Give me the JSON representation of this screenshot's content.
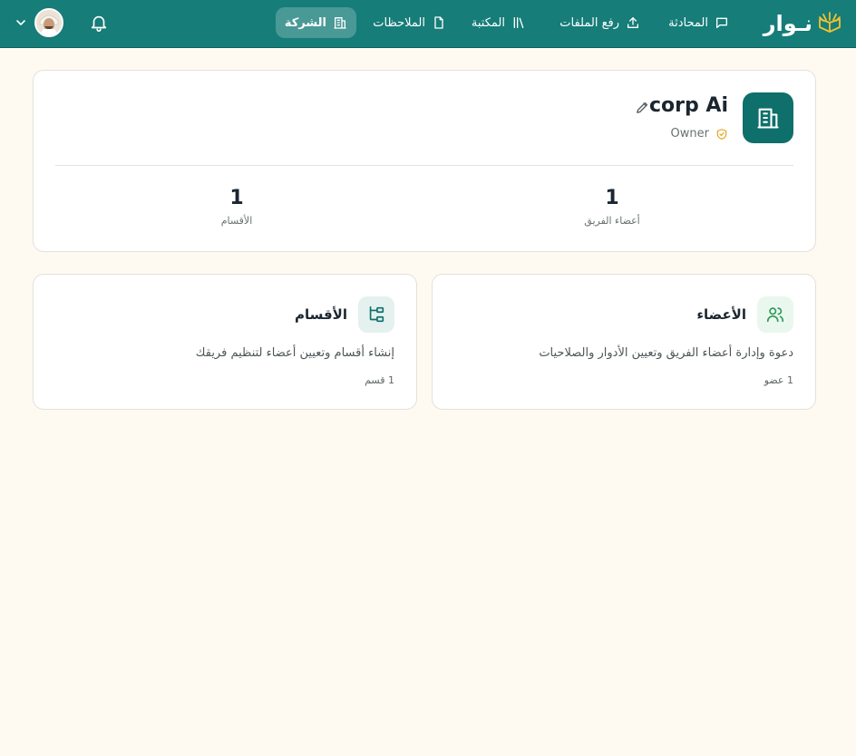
{
  "header": {
    "logo_text": "نـوار",
    "nav": [
      {
        "label": "المحادثة",
        "icon": "chat-icon",
        "active": false
      },
      {
        "label": "رفع الملفات",
        "icon": "upload-icon",
        "active": false
      },
      {
        "label": "المكتبة",
        "icon": "library-icon",
        "active": false
      },
      {
        "label": "الملاحظات",
        "icon": "note-icon",
        "active": false
      },
      {
        "label": "الشركة",
        "icon": "building-icon",
        "active": true
      }
    ],
    "notifications_icon": "bell-icon",
    "avatar_icon": "avatar",
    "menu_icon": "chevron-down-icon"
  },
  "company": {
    "name": "corp Ai",
    "role": "Owner",
    "stats": [
      {
        "value": "1",
        "label": "أعضاء الفريق"
      },
      {
        "value": "1",
        "label": "الأقسام"
      }
    ]
  },
  "features": {
    "members": {
      "title": "الأعضاء",
      "description": "دعوة وإدارة أعضاء الفريق وتعيين الأدوار والصلاحيات",
      "count": "1 عضو"
    },
    "departments": {
      "title": "الأقسام",
      "description": "إنشاء أقسام وتعيين أعضاء لتنظيم فريقك",
      "count": "1 قسم"
    }
  },
  "colors": {
    "header_bg": "#167d79",
    "page_bg": "#fefaf2",
    "accent": "#0f6f6b",
    "owner_badge": "#e3a21a",
    "members_icon": "#2e9a5a"
  }
}
